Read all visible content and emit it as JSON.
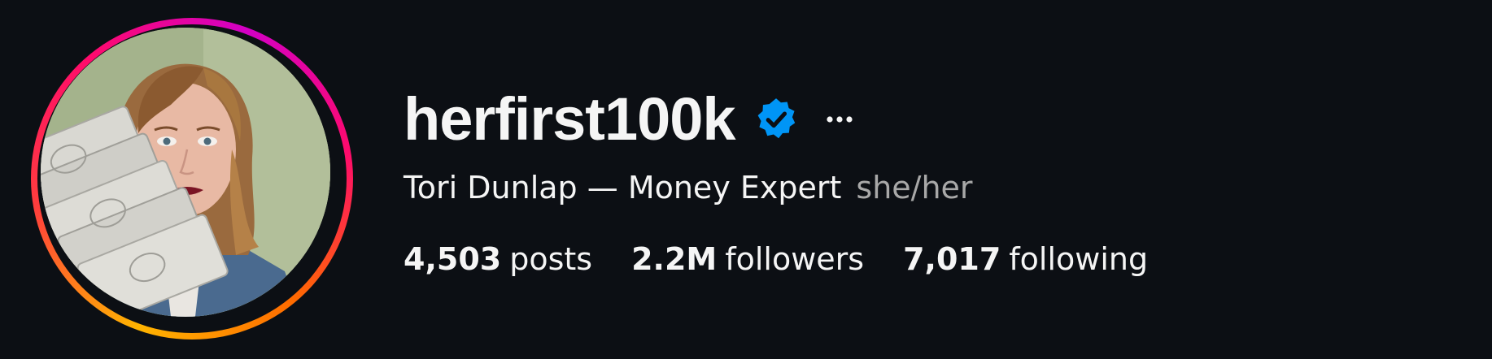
{
  "profile": {
    "username": "herfirst100k",
    "verified_icon": "verified-badge-icon",
    "more_icon": "more-options-icon",
    "full_name": "Tori Dunlap — Money Expert",
    "pronouns": "she/her",
    "avatar": {
      "description_icon": "profile-photo",
      "ring_colors": [
        "#ffb400",
        "#ff0a6c",
        "#d300c5"
      ]
    },
    "stats": {
      "posts": {
        "count": "4,503",
        "label": "posts"
      },
      "followers": {
        "count": "2.2M",
        "label": "followers"
      },
      "following": {
        "count": "7,017",
        "label": "following"
      }
    }
  },
  "colors": {
    "background": "#0c0f14",
    "text_primary": "#f5f5f5",
    "text_secondary": "#a8a8a8",
    "verified_blue": "#0095f6"
  }
}
